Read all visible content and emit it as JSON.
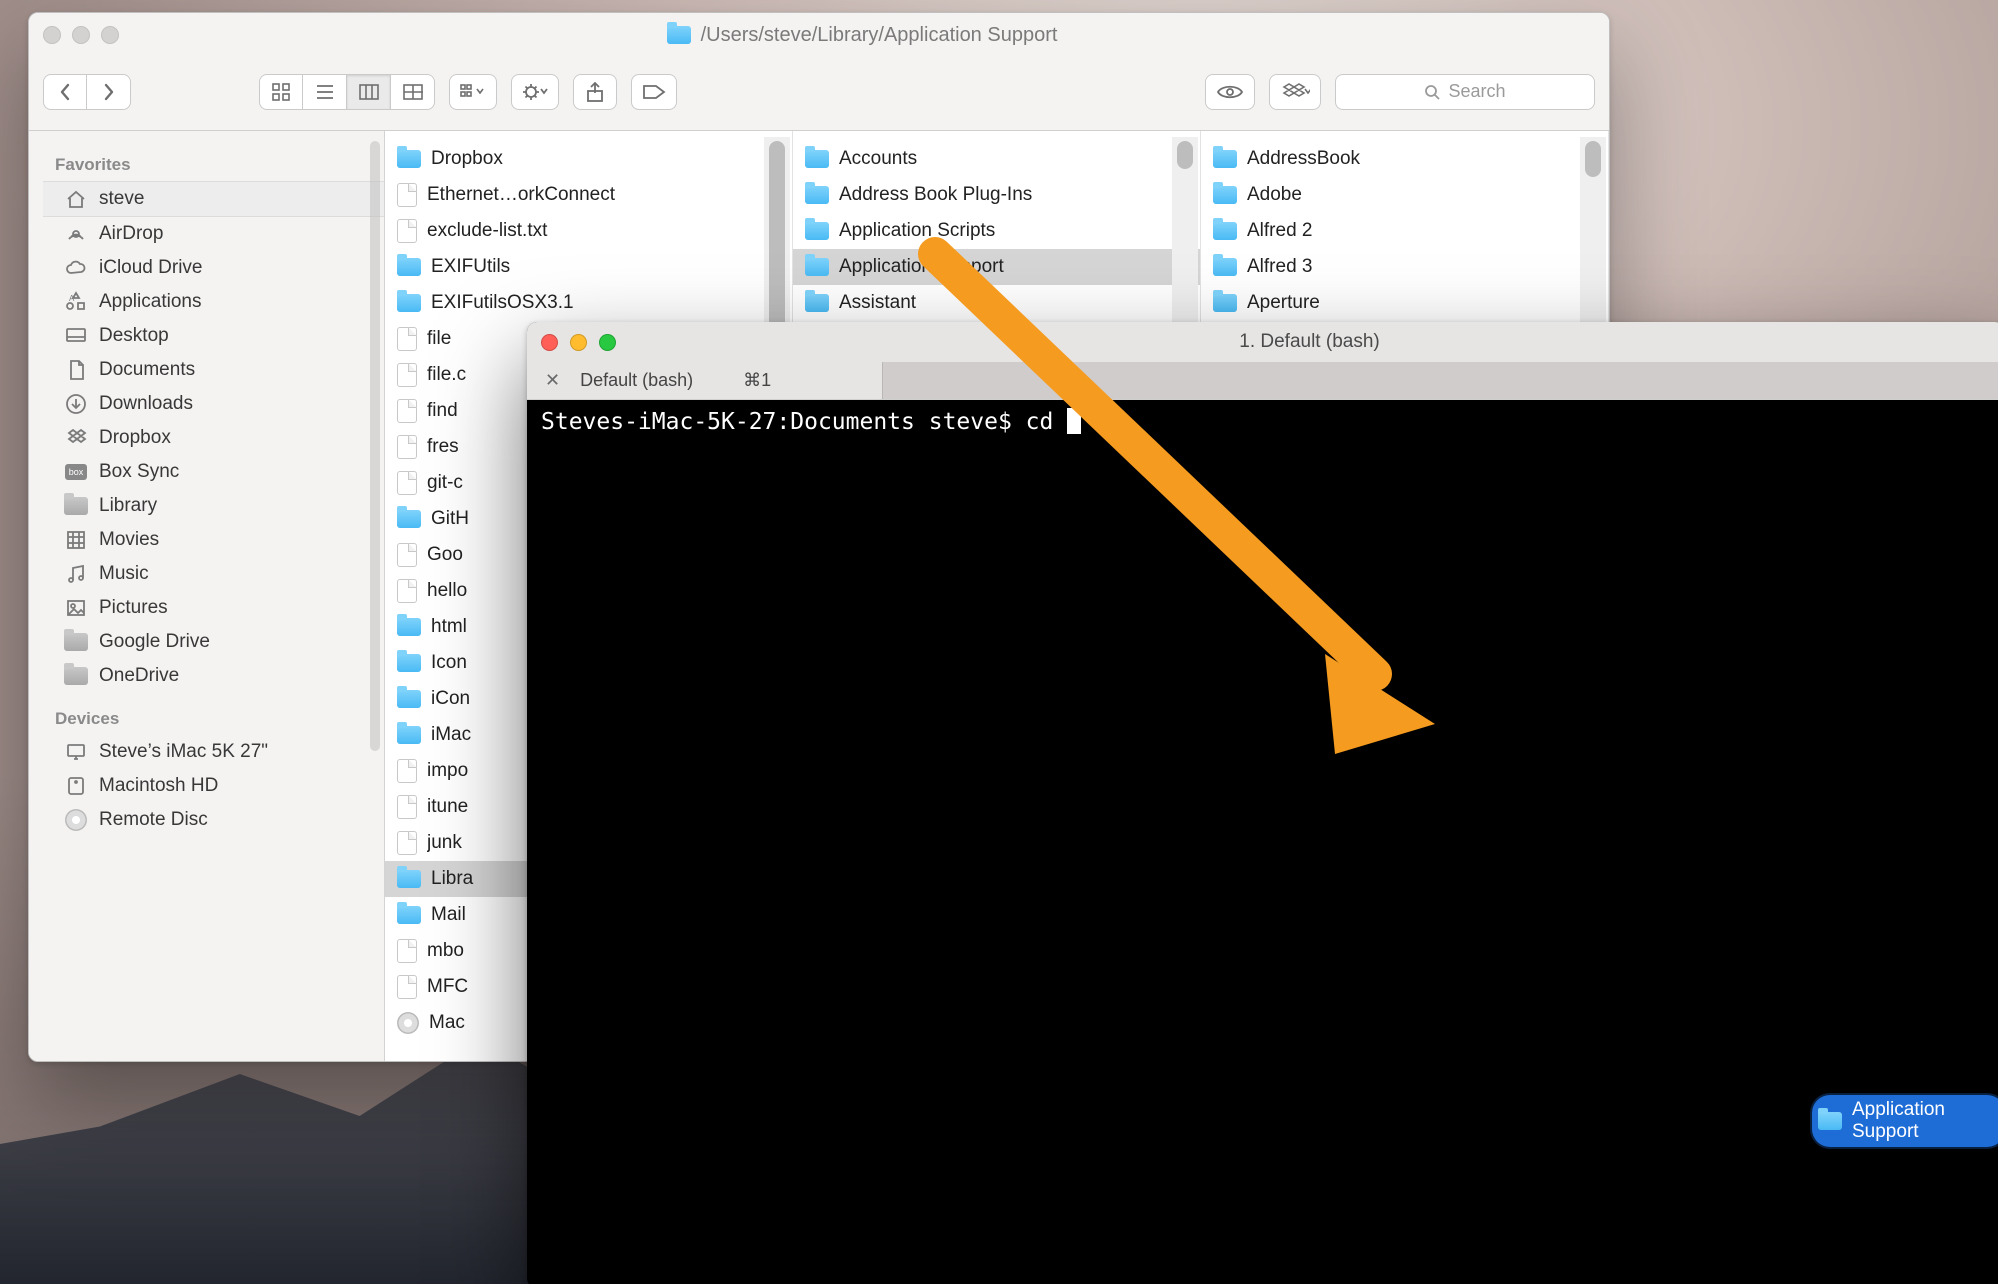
{
  "finder": {
    "path_title": "/Users/steve/Library/Application Support",
    "search_placeholder": "Search",
    "sidebar": {
      "favorites_title": "Favorites",
      "devices_title": "Devices",
      "items": [
        {
          "label": "steve",
          "selected": true,
          "icon": "home"
        },
        {
          "label": "AirDrop",
          "icon": "airdrop"
        },
        {
          "label": "iCloud Drive",
          "icon": "cloud"
        },
        {
          "label": "Applications",
          "icon": "apps"
        },
        {
          "label": "Desktop",
          "icon": "desktop"
        },
        {
          "label": "Documents",
          "icon": "doc"
        },
        {
          "label": "Downloads",
          "icon": "down"
        },
        {
          "label": "Dropbox",
          "icon": "dropbox"
        },
        {
          "label": "Box Sync",
          "icon": "box"
        },
        {
          "label": "Library",
          "icon": "folder"
        },
        {
          "label": "Movies",
          "icon": "movies"
        },
        {
          "label": "Music",
          "icon": "music"
        },
        {
          "label": "Pictures",
          "icon": "pictures"
        },
        {
          "label": "Google Drive",
          "icon": "folder"
        },
        {
          "label": "OneDrive",
          "icon": "folder"
        }
      ],
      "devices": [
        {
          "label": "Steve’s iMac 5K 27\"",
          "icon": "imac"
        },
        {
          "label": "Macintosh HD",
          "icon": "hd"
        },
        {
          "label": "Remote Disc",
          "icon": "disc"
        }
      ]
    },
    "col1": [
      {
        "label": "Dropbox",
        "icon": "folder",
        "check": true
      },
      {
        "label": "Ethernet…orkConnect",
        "icon": "file"
      },
      {
        "label": "exclude-list.txt",
        "icon": "file"
      },
      {
        "label": "EXIFUtils",
        "icon": "folder",
        "chev": true
      },
      {
        "label": "EXIFutilsOSX3.1",
        "icon": "folder",
        "chev": true
      },
      {
        "label": "file",
        "icon": "file"
      },
      {
        "label": "file.c",
        "icon": "file"
      },
      {
        "label": "find",
        "icon": "file"
      },
      {
        "label": "fres",
        "icon": "file"
      },
      {
        "label": "git-c",
        "icon": "file"
      },
      {
        "label": "GitH",
        "icon": "folder"
      },
      {
        "label": "Goo",
        "icon": "file"
      },
      {
        "label": "hello",
        "icon": "file"
      },
      {
        "label": "html",
        "icon": "folder"
      },
      {
        "label": "Icon",
        "icon": "folder"
      },
      {
        "label": "iCon",
        "icon": "folder"
      },
      {
        "label": "iMac",
        "icon": "folder"
      },
      {
        "label": "impo",
        "icon": "file"
      },
      {
        "label": "itune",
        "icon": "file"
      },
      {
        "label": "junk",
        "icon": "file"
      },
      {
        "label": "Libra",
        "icon": "folder",
        "selected": true
      },
      {
        "label": "Mail",
        "icon": "folder"
      },
      {
        "label": "mbo",
        "icon": "file"
      },
      {
        "label": "MFC",
        "icon": "file"
      },
      {
        "label": "Mac",
        "icon": "disk"
      }
    ],
    "col2": [
      {
        "label": "Accounts",
        "chev": true
      },
      {
        "label": "Address Book Plug-Ins",
        "chev": true
      },
      {
        "label": "Application Scripts",
        "chev": true
      },
      {
        "label": "Application Support",
        "chev": true,
        "selected": true
      },
      {
        "label": "Assistant",
        "chev": true
      }
    ],
    "col3": [
      {
        "label": "AddressBook",
        "chev": true
      },
      {
        "label": "Adobe",
        "chev": true
      },
      {
        "label": "Alfred 2",
        "chev": true
      },
      {
        "label": "Alfred 3",
        "chev": true
      },
      {
        "label": "Aperture",
        "chev": true
      }
    ]
  },
  "terminal": {
    "title": "1. Default (bash)",
    "tab_label": "Default (bash)",
    "tab_shortcut": "⌘1",
    "prompt_line": "Steves-iMac-5K-27:Documents steve$ cd "
  },
  "drag": {
    "label": "Application Support"
  }
}
